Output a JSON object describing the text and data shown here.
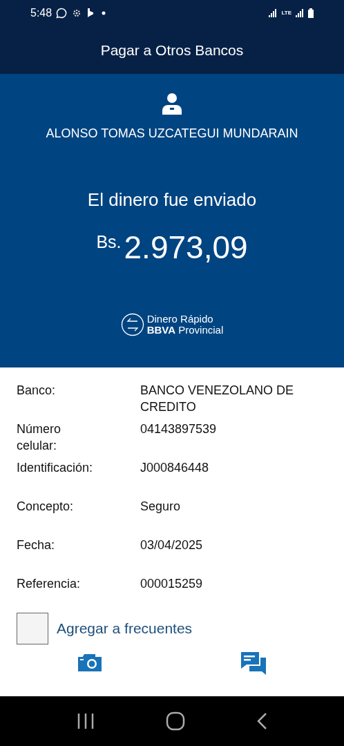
{
  "status_bar": {
    "time": "5:48",
    "network": "LTE"
  },
  "header": {
    "title": "Pagar a Otros Bancos"
  },
  "summary": {
    "recipient": "ALONSO TOMAS UZCATEGUI MUNDARAIN",
    "message": "El dinero fue enviado",
    "currency": "Bs.",
    "amount": "2.973,09",
    "brand_line_1": "Dinero Rápido",
    "brand_line_2_bold": "BBVA",
    "brand_line_2": "Provincial"
  },
  "details": [
    {
      "label": "Banco:",
      "value": "BANCO VENEZOLANO DE CREDITO"
    },
    {
      "label": "Número celular:",
      "value": "04143897539"
    },
    {
      "label": "Identificación:",
      "value": "J000846448"
    },
    {
      "label": "Concepto:",
      "value": "Seguro"
    },
    {
      "label": "Fecha:",
      "value": "03/04/2025"
    },
    {
      "label": "Referencia:",
      "value": "000015259"
    }
  ],
  "frequent": {
    "label": "Agregar a frecuentes",
    "checked": false
  }
}
